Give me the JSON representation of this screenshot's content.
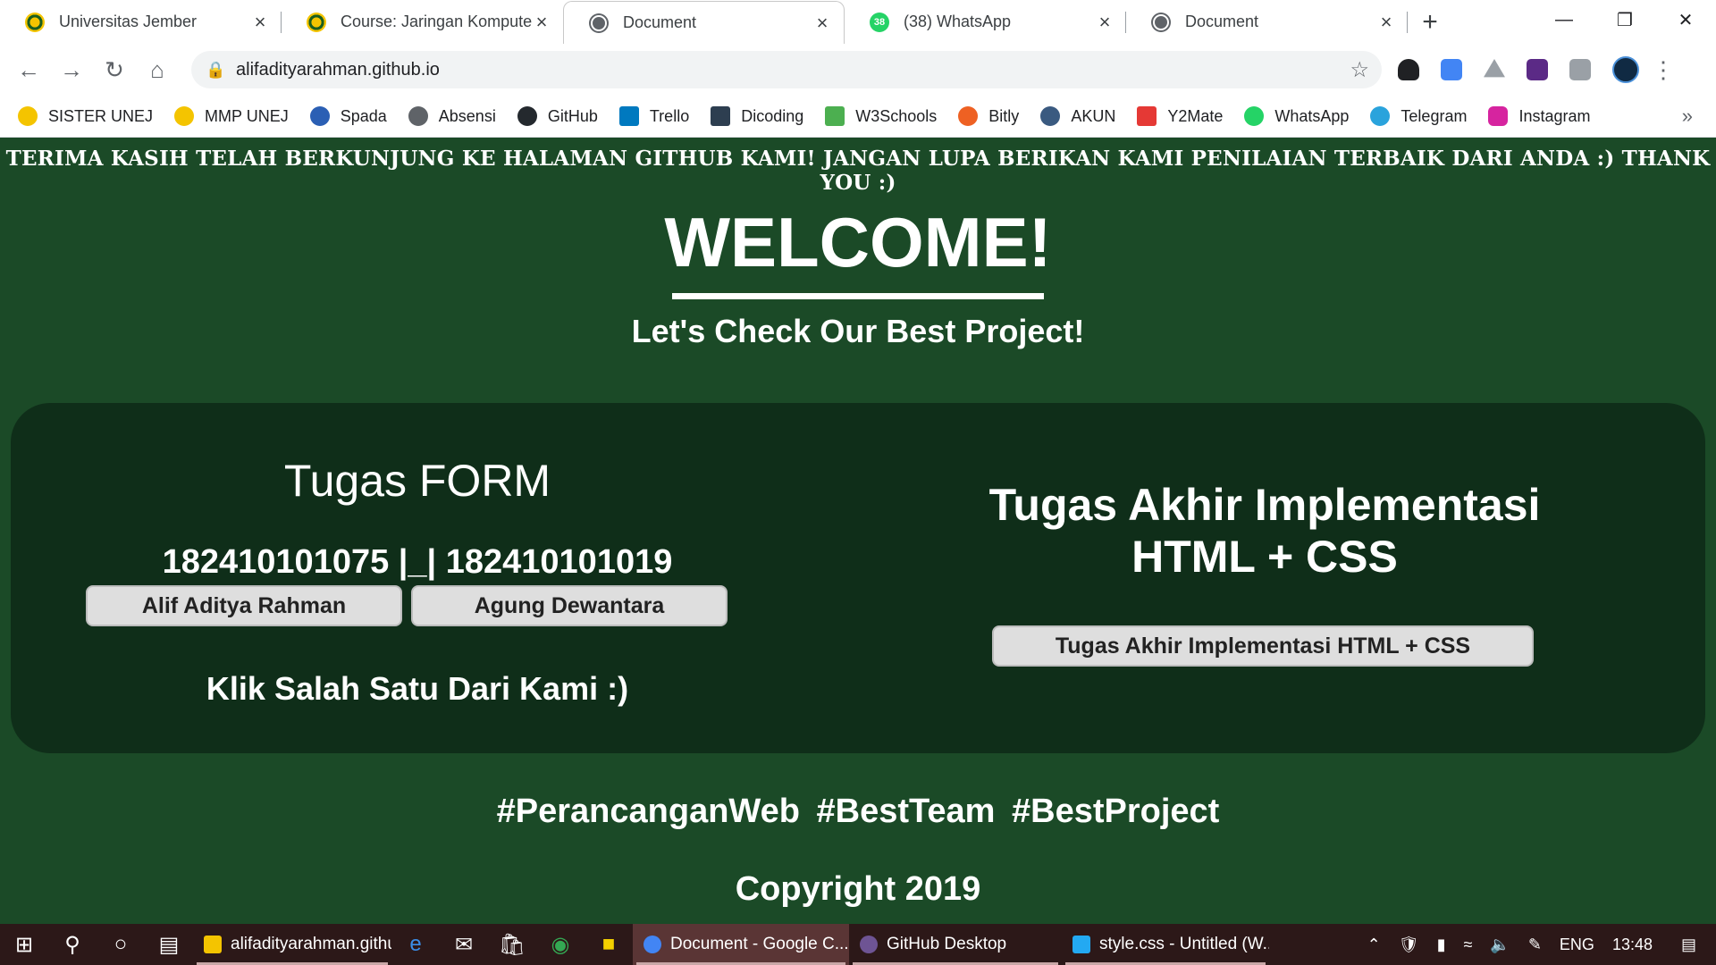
{
  "browser": {
    "tabs": [
      {
        "label": "Universitas Jember",
        "icon": "uj-logo-icon"
      },
      {
        "label": "Course: Jaringan Komputer",
        "icon": "uj-logo-icon"
      },
      {
        "label": "Document",
        "icon": "globe-icon",
        "active": true
      },
      {
        "label": "(38) WhatsApp",
        "icon": "whatsapp-icon",
        "badge": "38"
      },
      {
        "label": "Document",
        "icon": "globe-icon"
      }
    ],
    "url": "alifadityarahman.github.io",
    "bookmarks": [
      {
        "label": "SISTER UNEJ",
        "color": "#f4c400"
      },
      {
        "label": "MMP UNEJ",
        "color": "#f4c400"
      },
      {
        "label": "Spada",
        "color": "#2b5fb4"
      },
      {
        "label": "Absensi",
        "color": "#5f6368"
      },
      {
        "label": "GitHub",
        "color": "#24292e"
      },
      {
        "label": "Trello",
        "color": "#0079bf"
      },
      {
        "label": "Dicoding",
        "color": "#2d3e50"
      },
      {
        "label": "W3Schools",
        "color": "#4caf50"
      },
      {
        "label": "Bitly",
        "color": "#ee6123"
      },
      {
        "label": "AKUN",
        "color": "#3a5a80"
      },
      {
        "label": "Y2Mate",
        "color": "#e53935"
      },
      {
        "label": "WhatsApp",
        "color": "#25d366"
      },
      {
        "label": "Telegram",
        "color": "#2aa3dc"
      },
      {
        "label": "Instagram",
        "color": "#d6249f"
      }
    ]
  },
  "page": {
    "marquee": "TERIMA KASIH TELAH BERKUNJUNG KE HALAMAN GITHUB KAMI! JANGAN LUPA BERIKAN KAMI PENILAIAN TERBAIK DARI ANDA :) THANK YOU :)",
    "welcome": "WELCOME!",
    "subtitle": "Let's Check Our Best Project!",
    "form": {
      "title": "Tugas FORM",
      "nim": "182410101075 |_| 182410101019",
      "button_alif": "Alif Aditya Rahman",
      "button_agung": "Agung Dewantara",
      "hint": "Klik Salah Satu Dari Kami :)"
    },
    "akhir": {
      "title_line1": "Tugas Akhir Implementasi",
      "title_line2": "HTML + CSS",
      "button": "Tugas Akhir Implementasi HTML + CSS"
    },
    "tags": "#PerancanganWeb #BestTeam #BestProject",
    "copyright": "Copyright 2019",
    "colors": {
      "background": "#1b4a27",
      "panel": "#0f2e19",
      "button": "#dedede"
    }
  },
  "taskbar": {
    "apps": [
      {
        "label": "alifadityarahman.githu...",
        "color": "#f4c400"
      },
      {
        "label": "Document - Google C...",
        "color": "#4285f4",
        "active": true
      },
      {
        "label": "GitHub Desktop",
        "color": "#6e5494"
      },
      {
        "label": "style.css - Untitled (W...",
        "color": "#23a9f2"
      }
    ],
    "language": "ENG",
    "time": "13:48"
  }
}
